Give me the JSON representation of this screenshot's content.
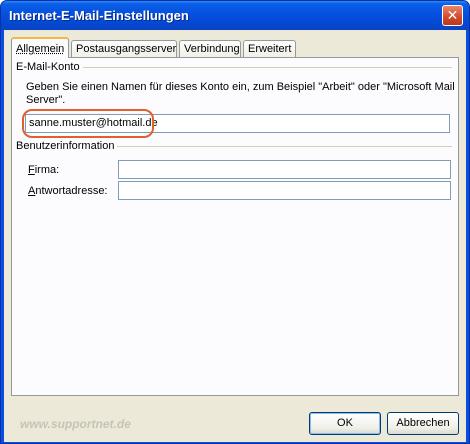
{
  "window": {
    "title": "Internet-E-Mail-Einstellungen",
    "close_glyph": "✕"
  },
  "tabs": [
    {
      "label": "Allgemein",
      "active": true
    },
    {
      "label": "Postausgangsserver",
      "active": false
    },
    {
      "label": "Verbindung",
      "active": false
    },
    {
      "label": "Erweitert",
      "active": false
    }
  ],
  "email_account": {
    "group_label": "E-Mail-Konto",
    "description_line1": "Geben Sie einen Namen für dieses Konto ein, zum Beispiel \"Arbeit\" oder \"Microsoft Mail",
    "description_line2": "Server\".",
    "account_name_value": "sanne.muster@hotmail.de"
  },
  "user_info": {
    "group_label": "Benutzerinformation",
    "company_label_hotkey": "F",
    "company_label_rest": "irma:",
    "company_value": "",
    "reply_label_hotkey": "A",
    "reply_label_rest": "ntwortadresse:",
    "reply_value": ""
  },
  "watermark": "www.supportnet.de",
  "buttons": {
    "ok": "OK",
    "cancel": "Abbrechen"
  },
  "colors": {
    "titlebar": "#0550de",
    "dialog_face": "#ece9d8",
    "highlight_ring": "#e0612e",
    "active_tab_accent": "#f5b645"
  }
}
